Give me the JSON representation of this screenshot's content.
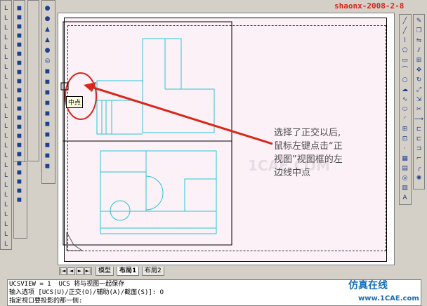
{
  "watermark_top": "shaonx-2008-2-8",
  "watermark_center": "1CAE.COM",
  "snap_tooltip": "中点",
  "annotation_lines": [
    "选择了正交以后,",
    "鼠标左键点击“正",
    "视图”视图框的左",
    "边线中点"
  ],
  "layout_tabs": {
    "nav": [
      "|◄",
      "◄",
      "►",
      "►|"
    ],
    "items": [
      {
        "label": "模型",
        "active": false
      },
      {
        "label": "布局1",
        "active": true
      },
      {
        "label": "布局2",
        "active": false
      }
    ]
  },
  "command_lines": [
    "UCSVIEW = 1  UCS 将与视图一起保存",
    "输入选项 [UCS(U)/正交(O)/辅助(A)/截面(S)]: O",
    "指定视口要投影的那一侧:"
  ],
  "branding": {
    "chinese": "仿真在线",
    "url": "www.1CAE.com"
  },
  "colors": {
    "drawing_lines": "#26c6d6",
    "paper": "#fcf1f6",
    "highlight_circle": "#d9251a",
    "arrow": "#d9251a",
    "watermark_text": "#d9251a",
    "branding": "#1a6fb8"
  },
  "toolbars": {
    "left_col1": [
      "ucs-icon",
      "ucs-icon",
      "ucs-icon",
      "ucs-icon",
      "ucs-icon",
      "ucs-icon",
      "ucs-icon",
      "ucs-icon",
      "ucs-icon",
      "ucs-icon",
      "ucs-icon",
      "ucs-icon",
      "ucs-icon",
      "ucs-icon",
      "ucs-icon",
      "ucs-icon",
      "ucs-icon",
      "ucs-icon",
      "ucs-icon",
      "ucs-icon",
      "ucs-icon",
      "ucs-icon",
      "ucs-icon",
      "ucs-icon",
      "ucs-icon"
    ],
    "left_col2": [
      "box-icon",
      "box-icon",
      "box-icon",
      "box-icon",
      "box-icon",
      "box-icon",
      "box-icon",
      "box-icon",
      "box-icon",
      "box-icon",
      "box-icon",
      "box-icon",
      "box-icon",
      "box-icon",
      "box-icon",
      "box-icon",
      "box-icon",
      "box-icon",
      "box-icon",
      "box-icon",
      "box-icon",
      "box-icon"
    ],
    "left_col3": [
      "sphere-icon",
      "sphere-icon",
      "cone-icon",
      "cone-icon",
      "sphere-icon",
      "torus-icon",
      "box-icon",
      "box-icon",
      "box-icon",
      "box-icon",
      "box-icon",
      "box-icon",
      "box-icon",
      "box-icon",
      "box-icon",
      "box-icon"
    ],
    "right_draw": [
      "line-icon",
      "line-icon",
      "polyline-icon",
      "polygon-icon",
      "rectangle-icon",
      "arc-icon",
      "circle-icon",
      "revcloud-icon",
      "spline-icon",
      "ellipse-icon",
      "ellipse-arc-icon",
      "insert-icon",
      "block-icon",
      "point-icon",
      "hatch-icon",
      "gradient-icon",
      "region-icon",
      "table-icon",
      "mtext-icon"
    ],
    "right_modify": [
      "erase-icon",
      "copy-icon",
      "mirror-icon",
      "offset-icon",
      "array-icon",
      "move-icon",
      "rotate-icon",
      "scale-icon",
      "stretch-icon",
      "trim-icon",
      "extend-icon",
      "break-icon",
      "break-icon",
      "join-icon",
      "chamfer-icon",
      "fillet-icon",
      "explode-icon"
    ]
  }
}
